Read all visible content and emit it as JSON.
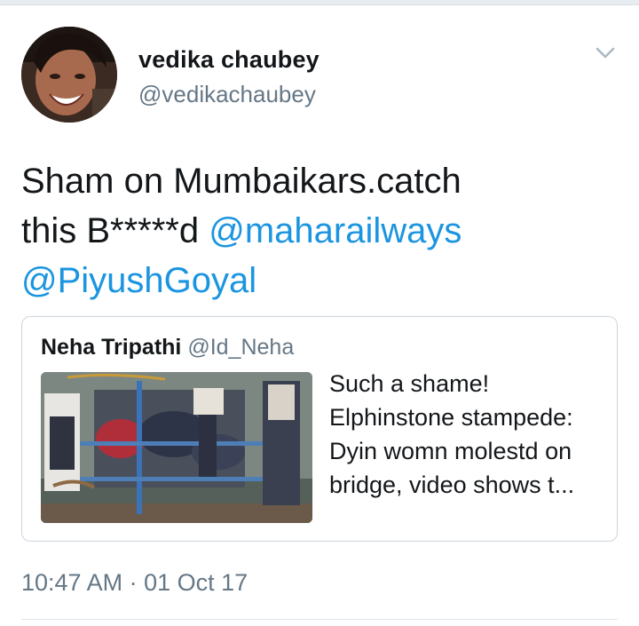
{
  "tweet": {
    "display_name": "vedika chaubey",
    "handle": "@vedikachaubey",
    "text_parts": {
      "line1": "Sham on Mumbaikars.catch",
      "line2_prefix": "this B*****d ",
      "mention1": "@maharailways",
      "mention2": "@PiyushGoyal"
    },
    "timestamp": "10:47 AM · 01 Oct 17"
  },
  "quoted": {
    "display_name": "Neha Tripathi",
    "handle": "@Id_Neha",
    "text": "Such a shame! Elphinstone stampede: Dyin womn molestd on bridge, video shows t..."
  },
  "icons": {
    "caret": "chevron-down-icon",
    "avatar": "user-avatar"
  },
  "colors": {
    "link": "#1b95e0",
    "secondary": "#657786",
    "border": "#ccd6dd"
  }
}
